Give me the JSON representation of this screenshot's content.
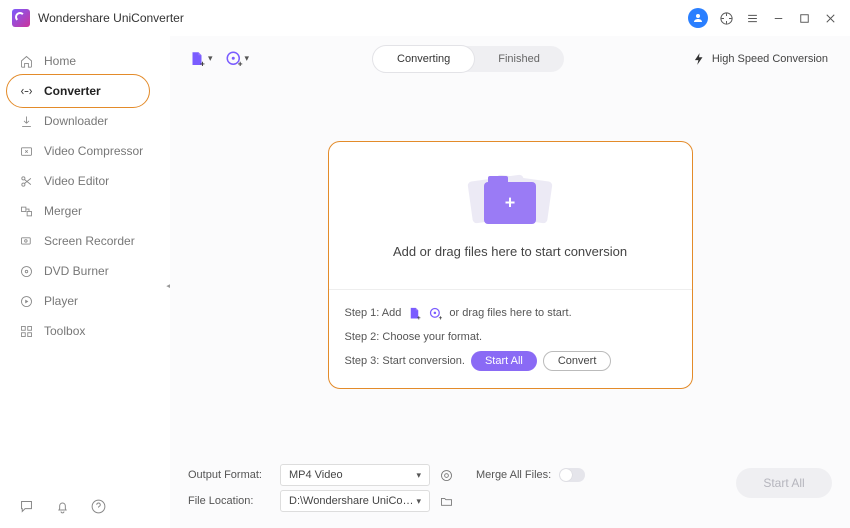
{
  "app": {
    "title": "Wondershare UniConverter"
  },
  "sidebar": {
    "items": [
      {
        "label": "Home",
        "icon": "home-icon"
      },
      {
        "label": "Converter",
        "icon": "converter-icon"
      },
      {
        "label": "Downloader",
        "icon": "download-icon"
      },
      {
        "label": "Video Compressor",
        "icon": "compress-icon"
      },
      {
        "label": "Video Editor",
        "icon": "scissors-icon"
      },
      {
        "label": "Merger",
        "icon": "merger-icon"
      },
      {
        "label": "Screen Recorder",
        "icon": "recorder-icon"
      },
      {
        "label": "DVD Burner",
        "icon": "dvd-icon"
      },
      {
        "label": "Player",
        "icon": "play-icon"
      },
      {
        "label": "Toolbox",
        "icon": "toolbox-icon"
      }
    ],
    "active_index": 1
  },
  "toolbar": {
    "tabs": {
      "converting": "Converting",
      "finished": "Finished"
    },
    "hsc_label": "High Speed Conversion"
  },
  "drop": {
    "heading": "Add or drag files here to start conversion",
    "step1_prefix": "Step 1: Add",
    "step1_suffix": "or drag files here to start.",
    "step2": "Step 2: Choose your format.",
    "step3_prefix": "Step 3: Start conversion.",
    "btn_start_all": "Start All",
    "btn_convert": "Convert"
  },
  "bottom": {
    "output_format_label": "Output Format:",
    "output_format_value": "MP4 Video",
    "file_location_label": "File Location:",
    "file_location_value": "D:\\Wondershare UniConverter",
    "merge_label": "Merge All Files:",
    "start_all": "Start All"
  }
}
